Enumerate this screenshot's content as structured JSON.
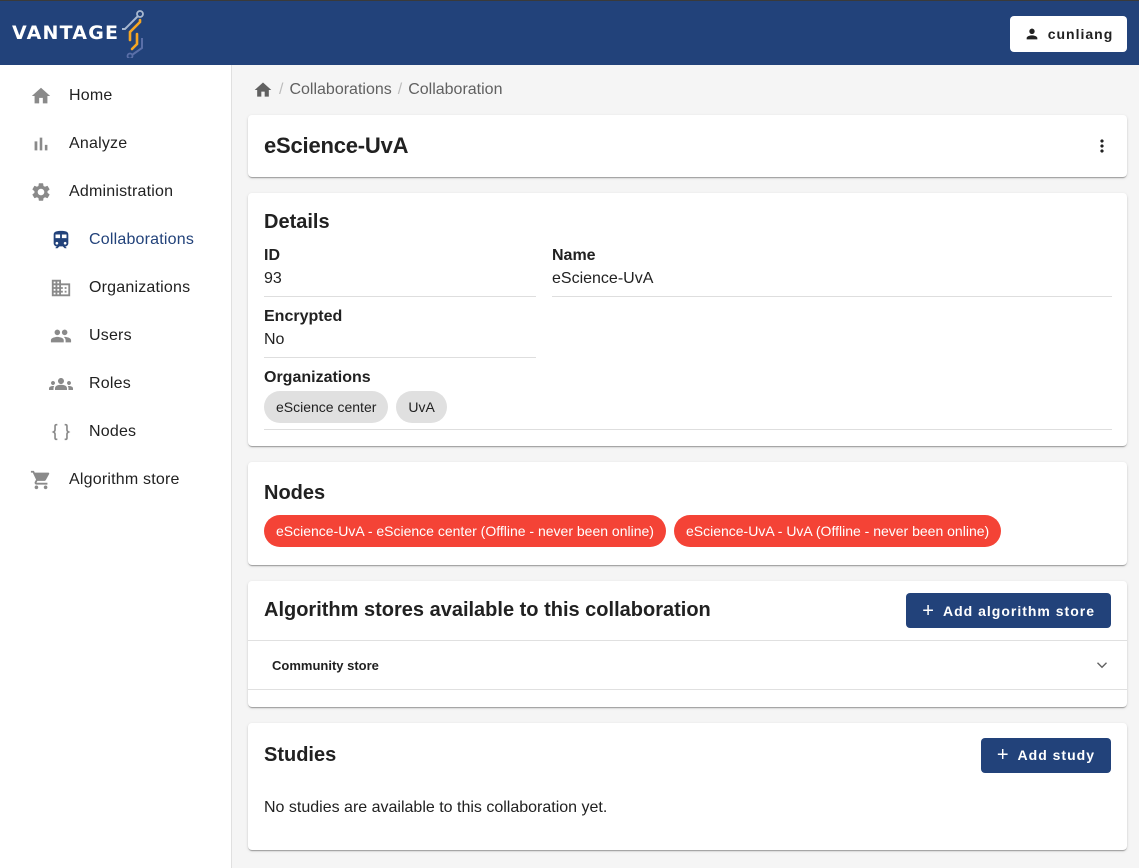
{
  "header": {
    "logo_text": "VANTAGE",
    "user": {
      "icon": "person-icon",
      "name": "cunliang"
    },
    "brand_color": "#22427a"
  },
  "sidebar": {
    "items": [
      {
        "label": "Home",
        "icon": "home-icon",
        "level": "top",
        "active": false
      },
      {
        "label": "Analyze",
        "icon": "bar-chart-icon",
        "level": "top",
        "active": false
      },
      {
        "label": "Administration",
        "icon": "gear-icon",
        "level": "top",
        "active": false
      },
      {
        "label": "Collaborations",
        "icon": "train-icon",
        "level": "sub",
        "active": true
      },
      {
        "label": "Organizations",
        "icon": "building-icon",
        "level": "sub",
        "active": false
      },
      {
        "label": "Users",
        "icon": "users-icon",
        "level": "sub",
        "active": false
      },
      {
        "label": "Roles",
        "icon": "groups-icon",
        "level": "sub",
        "active": false
      },
      {
        "label": "Nodes",
        "icon": "braces-icon",
        "level": "sub",
        "active": false
      },
      {
        "label": "Algorithm store",
        "icon": "cart-icon",
        "level": "top",
        "active": false
      }
    ]
  },
  "breadcrumb": {
    "home_icon": "home-icon",
    "items": [
      "Collaborations",
      "Collaboration"
    ],
    "separator": "/"
  },
  "page": {
    "title": "eScience-UvA",
    "menu_icon": "more-vert-icon"
  },
  "details": {
    "title": "Details",
    "id_label": "ID",
    "id_value": "93",
    "name_label": "Name",
    "name_value": "eScience-UvA",
    "encrypted_label": "Encrypted",
    "encrypted_value": "No",
    "organizations_label": "Organizations",
    "organizations": [
      "eScience center",
      "UvA"
    ]
  },
  "nodes": {
    "title": "Nodes",
    "items": [
      "eScience-UvA - eScience center (Offline - never been online)",
      "eScience-UvA - UvA (Offline - never been online)"
    ],
    "offline_color": "#f44336"
  },
  "algorithm_stores": {
    "title": "Algorithm stores available to this collaboration",
    "add_button": "Add algorithm store",
    "stores": [
      {
        "name": "Community store",
        "expanded": false
      }
    ]
  },
  "studies": {
    "title": "Studies",
    "add_button": "Add study",
    "empty_message": "No studies are available to this collaboration yet."
  }
}
